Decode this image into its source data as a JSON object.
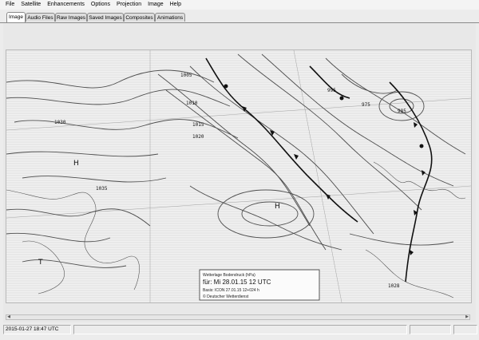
{
  "menu": [
    "File",
    "Satellite",
    "Enhancements",
    "Options",
    "Projection",
    "Image",
    "Help"
  ],
  "tabs": [
    {
      "label": "Image",
      "active": true
    },
    {
      "label": "Audio Files",
      "active": false
    },
    {
      "label": "Raw Images",
      "active": false
    },
    {
      "label": "Saved Images",
      "active": false
    },
    {
      "label": "Composites",
      "active": false
    },
    {
      "label": "Animations",
      "active": false
    }
  ],
  "image": {
    "type": "weather-fax-surface-pressure-chart",
    "isobar_labels": [
      "1005",
      "1010",
      "1015",
      "1020",
      "1030",
      "995",
      "985",
      "975",
      "1035",
      "1028"
    ],
    "pressure_marks": [
      "H",
      "T",
      "H"
    ],
    "caption_line1": "Wetterlage Bodendruck (hPa)",
    "caption_line2": "für:  Mi 28.01.15  12 UTC",
    "caption_line3": "Basis: ICON  27.01.15 12+024 h",
    "caption_line4": "© Deutscher Wetterdienst"
  },
  "status": {
    "datetime": "2015-01-27  18:47 UTC"
  }
}
